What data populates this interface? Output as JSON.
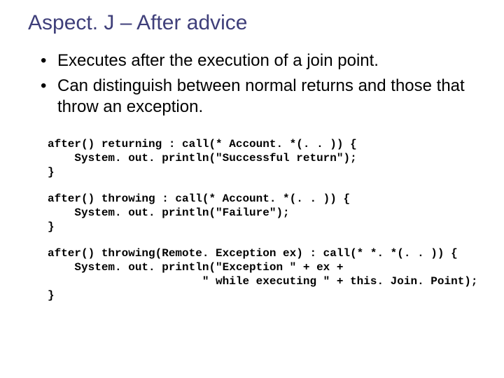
{
  "title": "Aspect. J – After advice",
  "bullets": [
    "Executes after the execution of a join point.",
    "Can distinguish between normal returns and those that throw an exception."
  ],
  "code_blocks": [
    "after() returning : call(* Account. *(. . )) {\n    System. out. println(\"Successful return\");\n}",
    "after() throwing : call(* Account. *(. . )) {\n    System. out. println(\"Failure\");\n}",
    "after() throwing(Remote. Exception ex) : call(* *. *(. . )) {\n    System. out. println(\"Exception \" + ex +\n                       \" while executing \" + this. Join. Point);\n}"
  ]
}
